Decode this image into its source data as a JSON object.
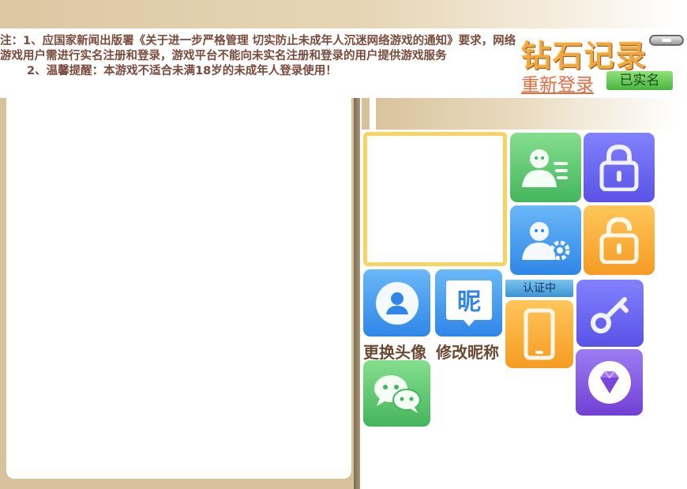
{
  "notice": {
    "line1": "注：1、应国家新闻出版署《关于进一步严格管理 切实防止未成年人沉迷网络游戏的通知》要求，网络游戏用户需进行实名注册和登录，游戏平台不能向未实名注册和登录的用户提供游戏服务",
    "line2": "2、温馨提醒：本游戏不适合未满18岁的未成年人登录使用！"
  },
  "header": {
    "diamond_records": "钻石记录",
    "relogin": "重新登录",
    "verified": "已实名"
  },
  "actions": {
    "change_avatar": "更换头像",
    "change_nickname": "修改昵称",
    "nickname_glyph": "昵",
    "verifying": "认证中"
  },
  "colors": {
    "accent_gold": "#f0a742",
    "notice_text": "#7a4a3a",
    "verified_green": "#4bb53e",
    "frame_yellow": "#f7d361"
  }
}
